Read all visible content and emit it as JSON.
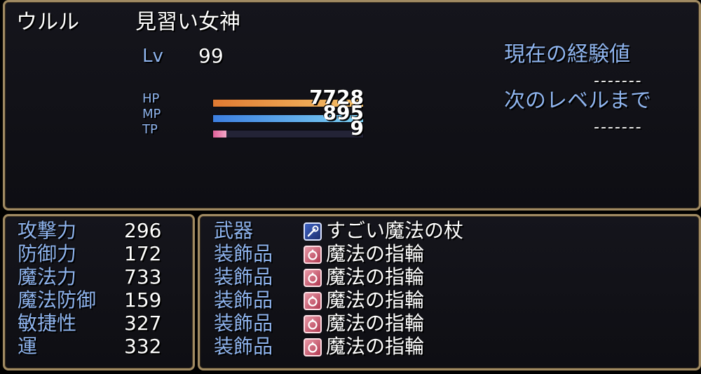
{
  "actor": {
    "name": "ウルル",
    "class": "見習い女神",
    "level_label": "Lv",
    "level": "99"
  },
  "gauges": [
    {
      "label": "HP",
      "value": "7728",
      "fill": 1.0,
      "color_from": "#e07a32",
      "color_to": "#f6c269"
    },
    {
      "label": "MP",
      "value": "895",
      "fill": 1.0,
      "color_from": "#3d7fe0",
      "color_to": "#7cd0f2"
    },
    {
      "label": "TP",
      "value": "9",
      "fill": 0.09,
      "color_from": "#e0609a",
      "color_to": "#f4a8c8"
    }
  ],
  "exp": {
    "current_label": "現在の経験値",
    "current_value": "-------",
    "next_label": "次のレベルまで",
    "next_value": "-------"
  },
  "params": [
    {
      "name": "攻撃力",
      "value": "296"
    },
    {
      "name": "防御力",
      "value": "172"
    },
    {
      "name": "魔法力",
      "value": "733"
    },
    {
      "name": "魔法防御",
      "value": "159"
    },
    {
      "name": "敏捷性",
      "value": "327"
    },
    {
      "name": "運",
      "value": "332"
    }
  ],
  "equips": [
    {
      "slot": "武器",
      "icon": "wand-icon",
      "item": "すごい魔法の杖"
    },
    {
      "slot": "装飾品",
      "icon": "ring-icon",
      "item": "魔法の指輪"
    },
    {
      "slot": "装飾品",
      "icon": "ring-icon",
      "item": "魔法の指輪"
    },
    {
      "slot": "装飾品",
      "icon": "ring-icon",
      "item": "魔法の指輪"
    },
    {
      "slot": "装飾品",
      "icon": "ring-icon",
      "item": "魔法の指輪"
    },
    {
      "slot": "装飾品",
      "icon": "ring-icon",
      "item": "魔法の指輪"
    }
  ],
  "colors": {
    "system": "#8fb4ee",
    "frame": "#a08a62",
    "gauge_back": "#232336"
  }
}
